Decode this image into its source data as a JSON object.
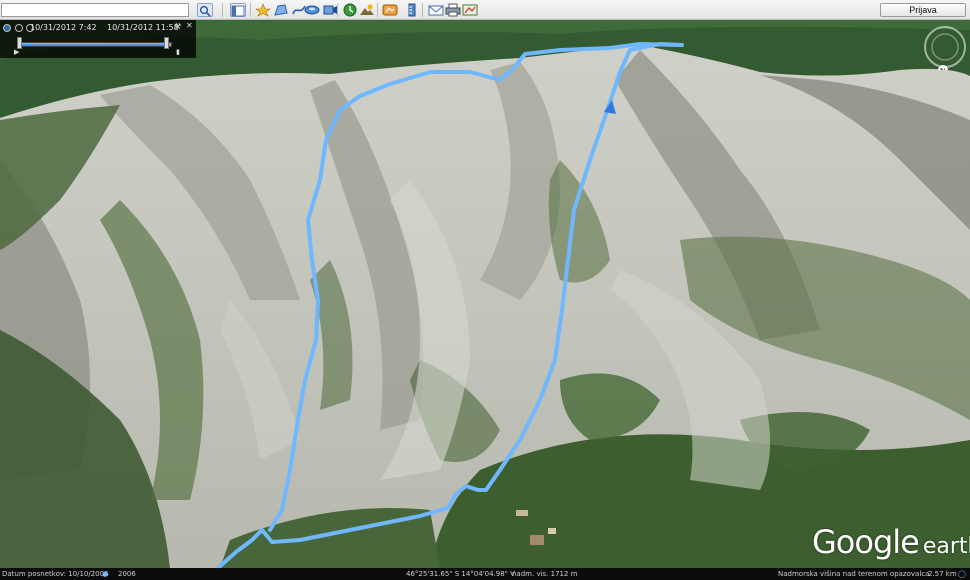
{
  "toolbar": {
    "search_value": "",
    "signin_label": "Prijava",
    "buttons": [
      {
        "name": "search-icon"
      },
      {
        "name": "sidebar-toggle-icon"
      },
      {
        "name": "placemark-icon"
      },
      {
        "name": "polygon-icon"
      },
      {
        "name": "path-icon"
      },
      {
        "name": "image-overlay-icon"
      },
      {
        "name": "record-tour-icon"
      },
      {
        "name": "historical-imagery-icon"
      },
      {
        "name": "sunlight-icon"
      },
      {
        "name": "switch-sky-icon"
      },
      {
        "name": "ruler-icon"
      },
      {
        "name": "email-icon"
      },
      {
        "name": "print-icon"
      },
      {
        "name": "view-in-maps-icon"
      }
    ]
  },
  "time_slider": {
    "start": "10/31/2012   7:42",
    "end": "10/31/2012   11:58",
    "position": 0.97
  },
  "status": {
    "imagery_date": "Datum posnetkov: 10/10/2006",
    "year": "2006",
    "coordinates": "46°25'31.65\" S  14°04'04.98\" V",
    "elevation": "nadm. vis.  1712 m",
    "eye_alt_label": "Nadmorska višina nad terenom opazovalca",
    "eye_alt_value": "2.57 km"
  },
  "logo": {
    "main": "Google",
    "sub": "earth"
  },
  "colors": {
    "track": "#6fb8ff",
    "toolbar": "#ececec",
    "status": "#0b0b0b"
  }
}
